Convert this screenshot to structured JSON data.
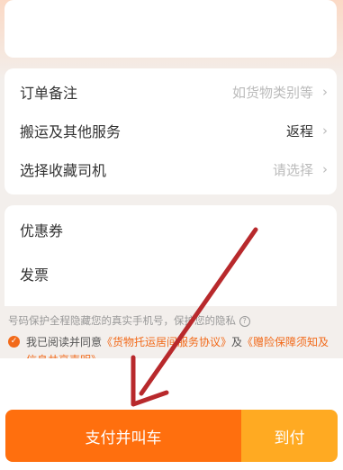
{
  "options": {
    "remark_label": "订单备注",
    "remark_value": "如货物类别等",
    "service_label": "搬运及其他服务",
    "service_value": "返程",
    "driver_label": "选择收藏司机",
    "driver_value": "请选择"
  },
  "promo": {
    "coupon_label": "优惠券",
    "invoice_label": "发票"
  },
  "privacy_text": "号码保护全程隐藏您的真实手机号，保护您的隐私",
  "agreement": {
    "prefix": "我已阅读并同意",
    "link1": "《货物托运居间服务协议》",
    "and": "及",
    "link2": "《赠险保障须知及信息共享声明》"
  },
  "buttons": {
    "pay_call": "支付并叫车",
    "cash_on_delivery": "到付"
  },
  "colors": {
    "accent": "#ff6f0e",
    "secondary": "#ffaa22",
    "annotation_arrow": "#b8292c"
  }
}
